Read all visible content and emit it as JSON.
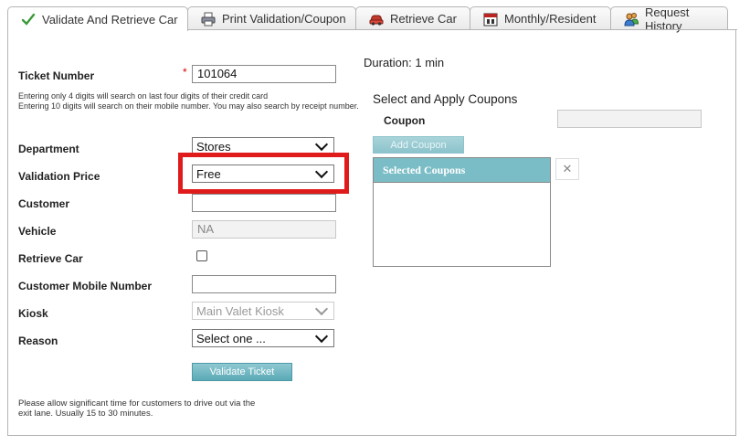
{
  "tabs": [
    {
      "label": "Validate And Retrieve Car",
      "icon": "checkmark-icon"
    },
    {
      "label": "Print Validation/Coupon",
      "icon": "printer-icon"
    },
    {
      "label": "Retrieve Car",
      "icon": "car-icon"
    },
    {
      "label": "Monthly/Resident",
      "icon": "calendar-icon"
    },
    {
      "label": "Request History",
      "icon": "users-icon"
    }
  ],
  "form": {
    "ticket_label": "Ticket Number",
    "ticket_required": "*",
    "ticket_value": "101064",
    "ticket_help_1": "Entering only 4 digits will search on last four digits of their credit card",
    "ticket_help_2": "Entering 10 digits will search on their mobile number. You may also search by receipt number.",
    "department_label": "Department",
    "department_value": "Stores",
    "validation_price_label": "Validation Price",
    "validation_price_value": "Free",
    "customer_label": "Customer",
    "customer_value": "",
    "vehicle_label": "Vehicle",
    "vehicle_value": "NA",
    "retrieve_car_label": "Retrieve Car",
    "retrieve_car_checked": false,
    "mobile_label": "Customer Mobile Number",
    "mobile_value": "",
    "kiosk_label": "Kiosk",
    "kiosk_value": "Main Valet Kiosk",
    "reason_label": "Reason",
    "reason_value": "Select one ...",
    "validate_button": "Validate Ticket",
    "footer_note": "Please allow significant time for customers to drive out via the exit lane. Usually 15 to 30 minutes."
  },
  "right": {
    "duration": "Duration: 1 min",
    "coupons_heading": "Select and Apply Coupons",
    "coupon_label": "Coupon",
    "coupon_value": "",
    "add_coupon_button": "Add Coupon",
    "selected_coupons_header": "Selected Coupons",
    "remove_symbol": "✕"
  },
  "colors": {
    "accent": "#7bbdc6",
    "highlight": "#e01b1b",
    "check_green": "#3a9a3a"
  }
}
